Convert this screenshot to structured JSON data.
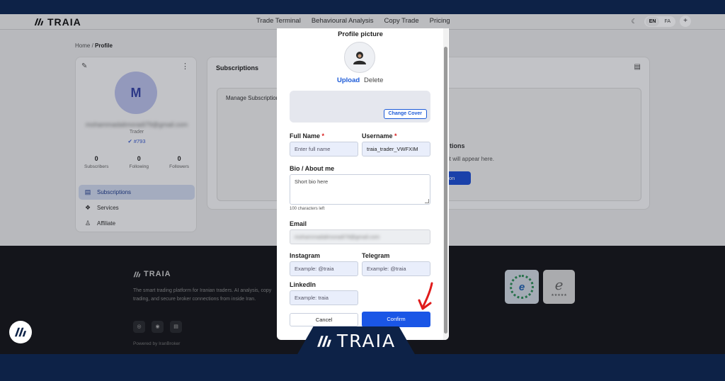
{
  "brand": "TRAIA",
  "nav": {
    "links": [
      "Trade Terminal",
      "Behavioural Analysis",
      "Copy Trade",
      "Pricing"
    ],
    "lang": [
      "EN",
      "FA"
    ],
    "plus": "+"
  },
  "breadcrumb": {
    "home": "Home",
    "sep": "/",
    "current": "Profile"
  },
  "profile": {
    "initial": "M",
    "email": "mohammadalimoradi79@gmail.com",
    "role": "Trader",
    "id": "#793",
    "stats": [
      {
        "value": "0",
        "label": "Subscribers"
      },
      {
        "value": "0",
        "label": "Following"
      },
      {
        "value": "0",
        "label": "Followers"
      }
    ],
    "menu": [
      "Subscriptions",
      "Services",
      "Affiliate"
    ]
  },
  "subscriptions": {
    "title": "Subscriptions",
    "tab": "Manage Subscriptions",
    "empty_title": "tions",
    "empty_sub": "it will appear here.",
    "empty_btn": "on"
  },
  "footer": {
    "brand": "TRAIA",
    "text": "The smart trading platform for Iranian traders. AI analysis, copy trading, and secure broker connections from inside Iran.",
    "powered": "Powered by IranBroker"
  },
  "modal": {
    "title": "Profile picture",
    "upload": "Upload",
    "delete": "Delete",
    "change_cover": "Change Cover",
    "full_name_label": "Full Name",
    "full_name_placeholder": "Enter full name",
    "username_label": "Username",
    "username_value": "traia_trader_VWFXIM",
    "required_mark": "*",
    "bio_label": "Bio / About me",
    "bio_placeholder": "Short bio here",
    "bio_hint": "100 characters left",
    "email_label": "Email",
    "email_value": "mohammadalimoradi79@gmail.com",
    "instagram_label": "Instagram",
    "instagram_placeholder": "Example: @traia",
    "telegram_label": "Telegram",
    "telegram_placeholder": "Example: @traia",
    "linkedin_label": "LinkedIn",
    "linkedin_placeholder": "Example: traia",
    "cancel": "Cancel",
    "confirm": "Confirm"
  },
  "overlay_brand": "TRAIA",
  "colors": {
    "primary": "#1a56e6",
    "navy": "#0d2247",
    "arrow": "#e01b1b"
  }
}
